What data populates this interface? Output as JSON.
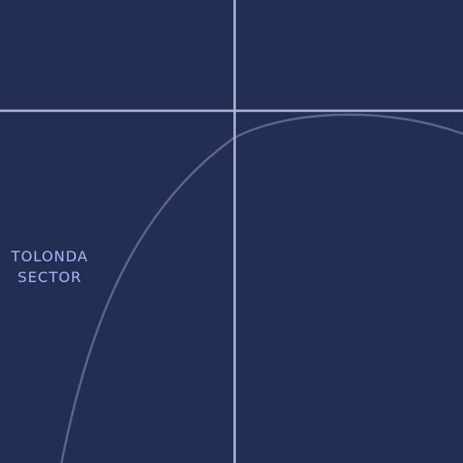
{
  "map": {
    "colors": {
      "background": "#232e55",
      "road": "#b4b8d4",
      "boundary": "#5d6589",
      "label": "#a9b4f2"
    },
    "labels": {
      "sector_line1": "TOLONDA",
      "sector_line2": "SECTOR"
    }
  }
}
